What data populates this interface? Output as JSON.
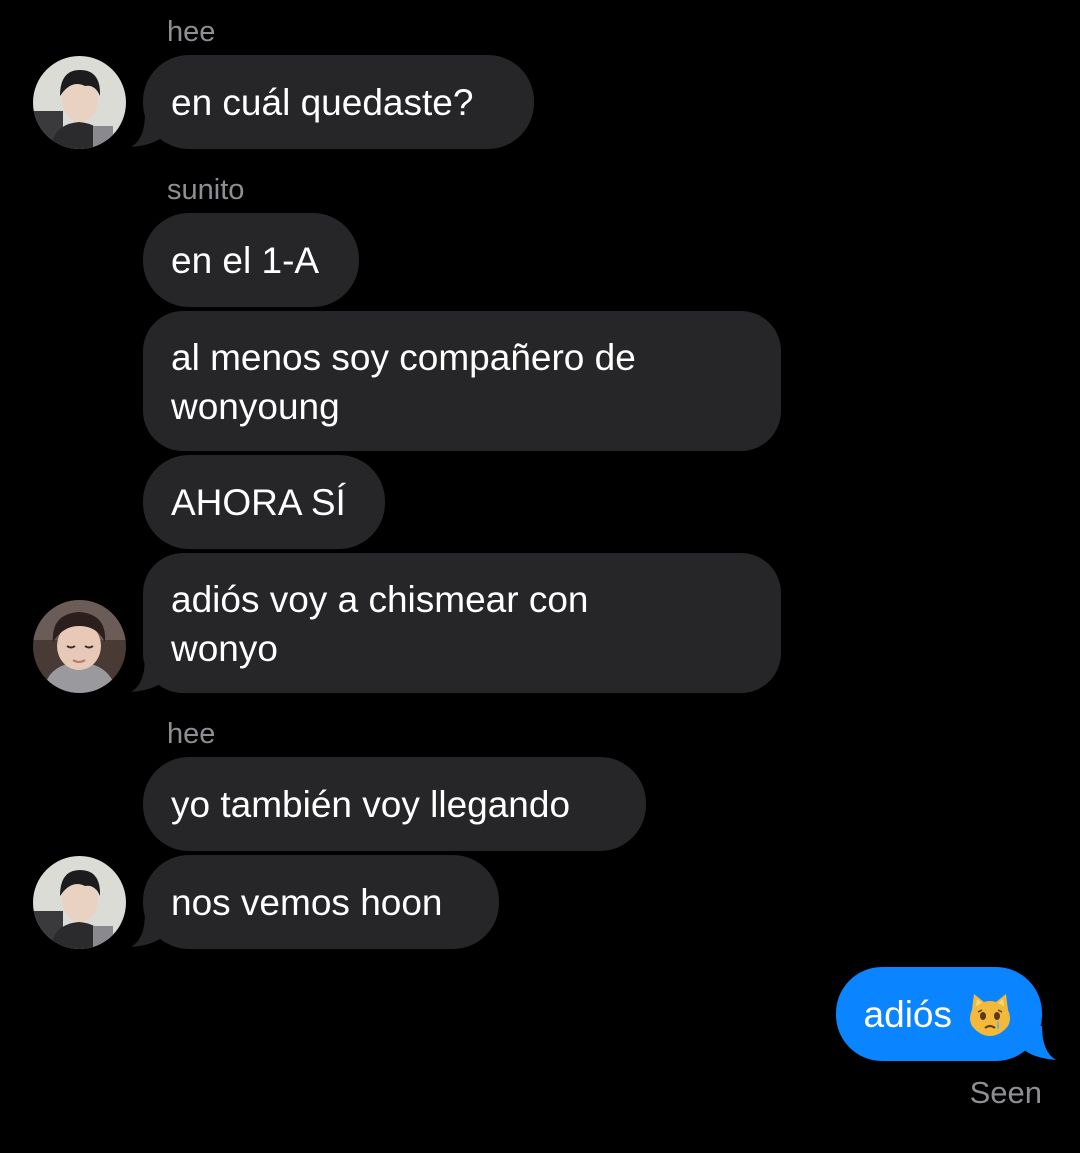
{
  "conversation": {
    "senders": [
      "hee",
      "sunito",
      "hee"
    ],
    "messages": [
      "en cuál quedaste?",
      "en el 1-A",
      "al menos soy compañero de wonyoung",
      "AHORA SÍ",
      "adiós voy a chismear con wonyo",
      "yo también voy llegando",
      "nos vemos hoon"
    ],
    "outgoing": {
      "text": "adiós",
      "emoji": "crying-cat-face-emoji"
    },
    "status": "Seen"
  },
  "colors": {
    "background": "#000000",
    "incoming_bubble": "#262628",
    "outgoing_bubble": "#0a84ff",
    "secondary_text": "#8e8e93"
  },
  "icons": {
    "avatars": [
      "avatar-hee",
      "avatar-sunito",
      "avatar-hee"
    ]
  }
}
